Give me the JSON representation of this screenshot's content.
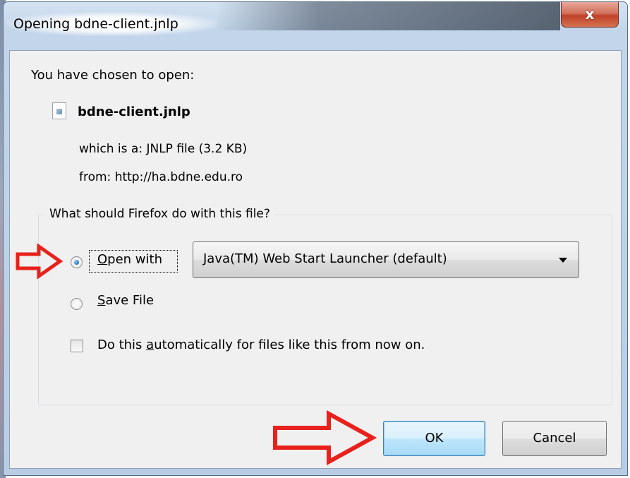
{
  "window": {
    "title": "Opening bdne-client.jnlp",
    "close_glyph": "x"
  },
  "dialog": {
    "intro": "You have chosen to open:",
    "file_name": "bdne-client.jnlp",
    "file_icon": "document-icon",
    "which_is": "which is a:  JNLP file (3.2 KB)",
    "from": "from:  http://ha.bdne.edu.ro",
    "question": "What should Firefox do with this file?",
    "open_with": {
      "prefix": "O",
      "rest": "pen with",
      "selected": true
    },
    "launcher_select": {
      "value": "Java(TM) Web Start Launcher (default)"
    },
    "save_file": {
      "prefix": "S",
      "rest": "ave File",
      "selected": false
    },
    "auto_checkbox": {
      "before": "Do this ",
      "underlined": "a",
      "after": "utomatically for files like this from now on.",
      "checked": false
    },
    "buttons": {
      "ok": "OK",
      "cancel": "Cancel"
    }
  },
  "annotations": {
    "arrow_color": "#e8211c"
  }
}
